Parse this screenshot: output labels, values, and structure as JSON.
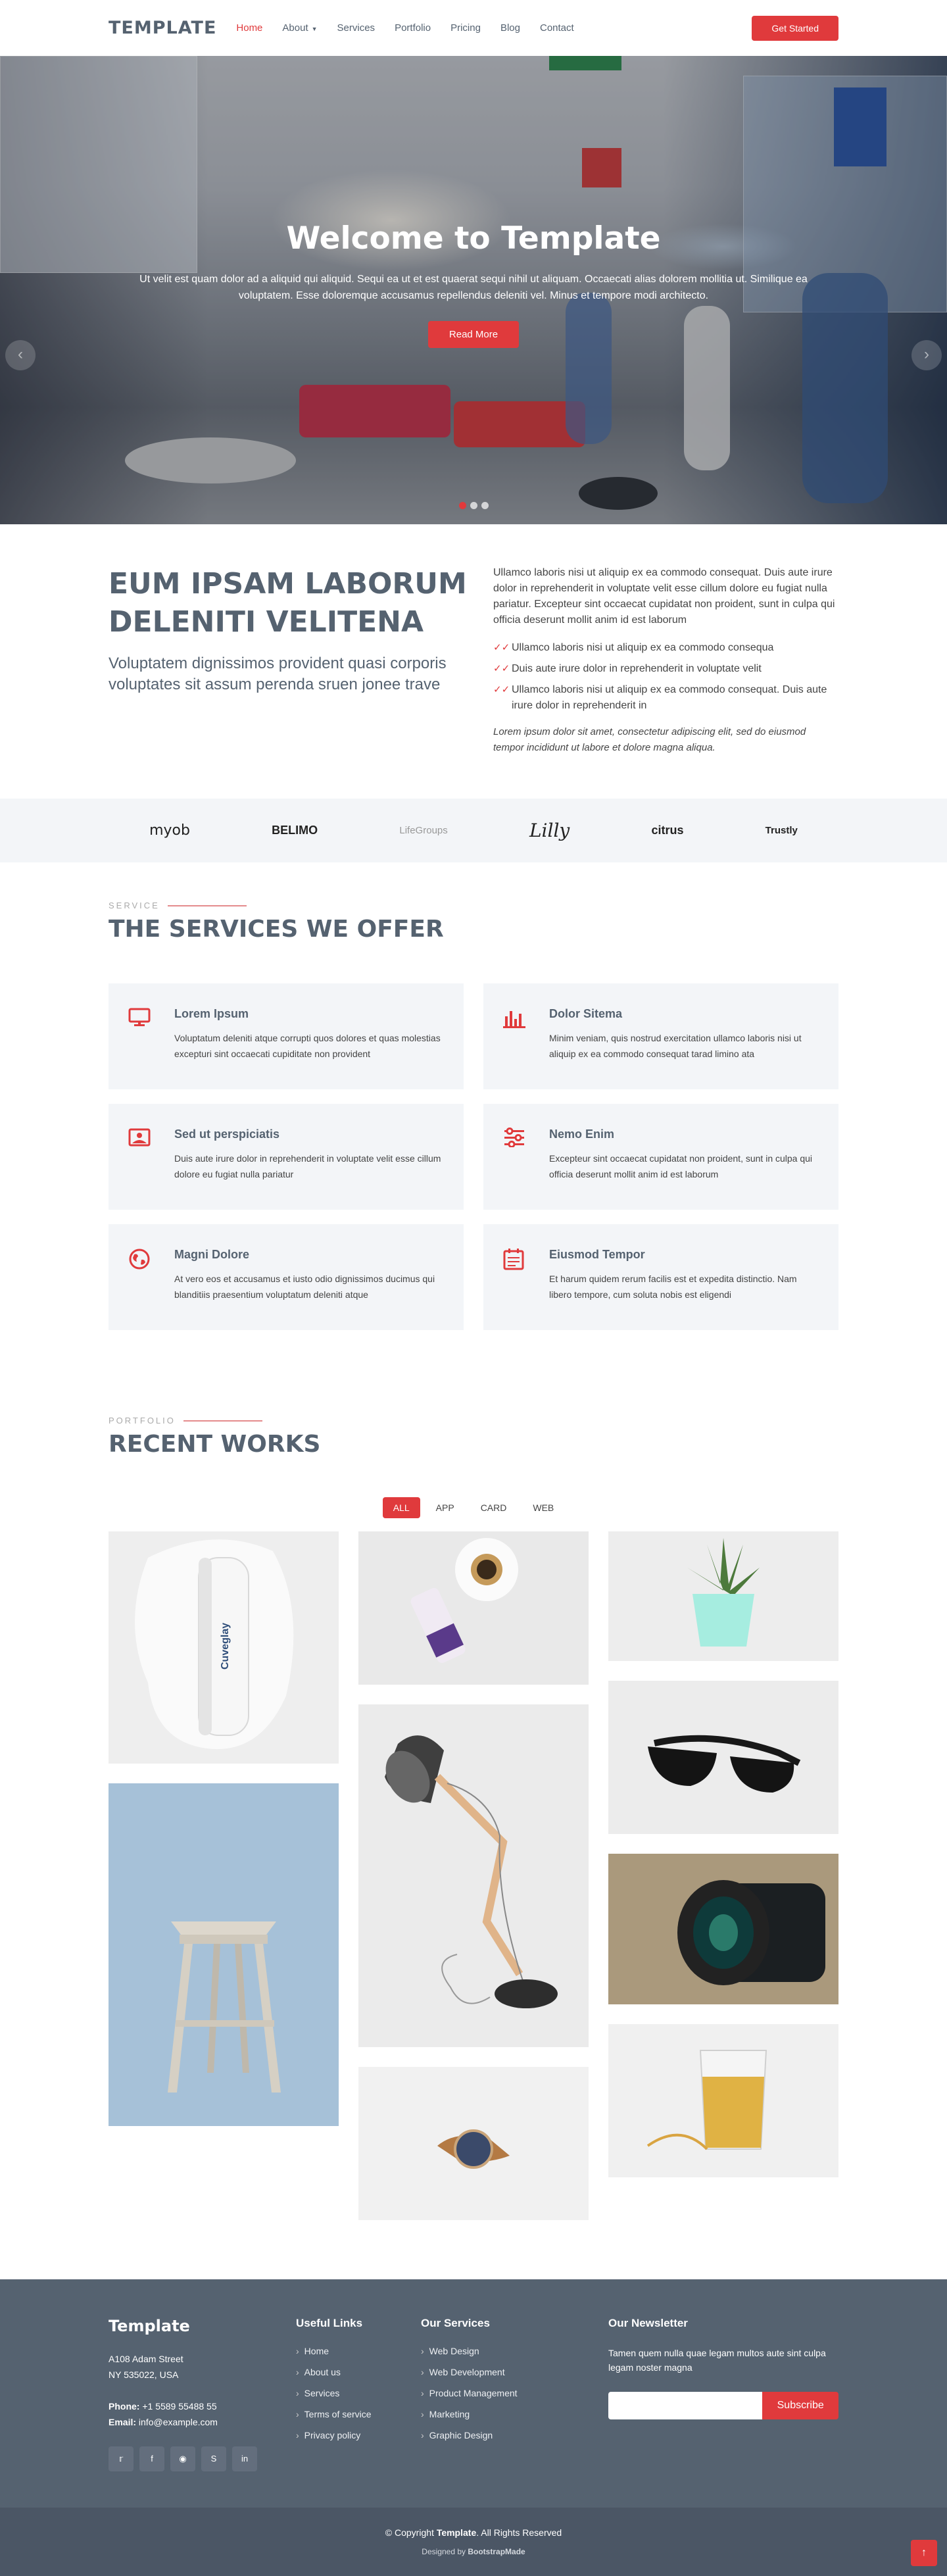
{
  "header": {
    "logo": "TEMPLATE",
    "nav": [
      {
        "label": "Home"
      },
      {
        "label": "About"
      },
      {
        "label": "Services"
      },
      {
        "label": "Portfolio"
      },
      {
        "label": "Pricing"
      },
      {
        "label": "Blog"
      },
      {
        "label": "Contact"
      }
    ],
    "cta": "Get Started"
  },
  "hero": {
    "title": "Welcome to Template",
    "text": "Ut velit est quam dolor ad a aliquid qui aliquid. Sequi ea ut et est quaerat sequi nihil ut aliquam. Occaecati alias dolorem mollitia ut. Similique ea voluptatem. Esse doloremque accusamus repellendus deleniti vel. Minus et tempore modi architecto.",
    "button": "Read More",
    "prev": "‹",
    "next": "›"
  },
  "about": {
    "heading": "EUM IPSAM LABORUM DELENITI VELITENA",
    "subheading": "Voluptatem dignissimos provident quasi corporis voluptates sit assum perenda sruen jonee trave",
    "paragraph": "Ullamco laboris nisi ut aliquip ex ea commodo consequat. Duis aute irure dolor in reprehenderit in voluptate velit esse cillum dolore eu fugiat nulla pariatur. Excepteur sint occaecat cupidatat non proident, sunt in culpa qui officia deserunt mollit anim id est laborum",
    "checks": [
      "Ullamco laboris nisi ut aliquip ex ea commodo consequa",
      "Duis aute irure dolor in reprehenderit in voluptate velit",
      "Ullamco laboris nisi ut aliquip ex ea commodo consequat. Duis aute irure dolor in reprehenderit in"
    ],
    "italic": "Lorem ipsum dolor sit amet, consectetur adipiscing elit, sed do eiusmod tempor incididunt ut labore et dolore magna aliqua."
  },
  "clients": [
    "myob",
    "BELIMO",
    "LifeGroups",
    "Lilly",
    "citrus",
    "Trustly"
  ],
  "services": {
    "tag": "SERVICE",
    "title": "THE SERVICES WE OFFER",
    "items": [
      {
        "icon": "monitor-icon",
        "title": "Lorem Ipsum",
        "text": "Voluptatum deleniti atque corrupti quos dolores et quas molestias excepturi sint occaecati cupiditate non provident"
      },
      {
        "icon": "bar-chart-icon",
        "title": "Dolor Sitema",
        "text": "Minim veniam, quis nostrud exercitation ullamco laboris nisi ut aliquip ex ea commodo consequat tarad limino ata"
      },
      {
        "icon": "image-icon",
        "title": "Sed ut perspiciatis",
        "text": "Duis aute irure dolor in reprehenderit in voluptate velit esse cillum dolore eu fugiat nulla pariatur"
      },
      {
        "icon": "sliders-icon",
        "title": "Nemo Enim",
        "text": "Excepteur sint occaecat cupidatat non proident, sunt in culpa qui officia deserunt mollit anim id est laborum"
      },
      {
        "icon": "globe-icon",
        "title": "Magni Dolore",
        "text": "At vero eos et accusamus et iusto odio dignissimos ducimus qui blanditiis praesentium voluptatum deleniti atque"
      },
      {
        "icon": "calendar-icon",
        "title": "Eiusmod Tempor",
        "text": "Et harum quidem rerum facilis est et expedita distinctio. Nam libero tempore, cum soluta nobis est eligendi"
      }
    ]
  },
  "portfolio": {
    "tag": "PORTFOLIO",
    "title": "RECENT WORKS",
    "filters": [
      "ALL",
      "APP",
      "CARD",
      "WEB"
    ],
    "bottle_label": "Cuveglay"
  },
  "footer": {
    "brand": "Template",
    "address_line1": "A108 Adam Street",
    "address_line2": "NY 535022, USA",
    "phone_label": "Phone:",
    "phone": "+1 5589 55488 55",
    "email_label": "Email:",
    "email": "info@example.com",
    "useful_links_title": "Useful Links",
    "useful_links": [
      "Home",
      "About us",
      "Services",
      "Terms of service",
      "Privacy policy"
    ],
    "services_title": "Our Services",
    "services": [
      "Web Design",
      "Web Development",
      "Product Management",
      "Marketing",
      "Graphic Design"
    ],
    "newsletter_title": "Our Newsletter",
    "newsletter_text": "Tamen quem nulla quae legam multos aute sint culpa legam noster magna",
    "subscribe": "Subscribe",
    "copyright_prefix": "© Copyright",
    "copyright_brand": "Template",
    "copyright_suffix": ". All Rights Reserved",
    "designed_prefix": "Designed by",
    "designed_by": "BootstrapMade"
  },
  "colors": {
    "accent": "#e03a3c",
    "heading": "#556270",
    "footer_bg": "#556270"
  }
}
